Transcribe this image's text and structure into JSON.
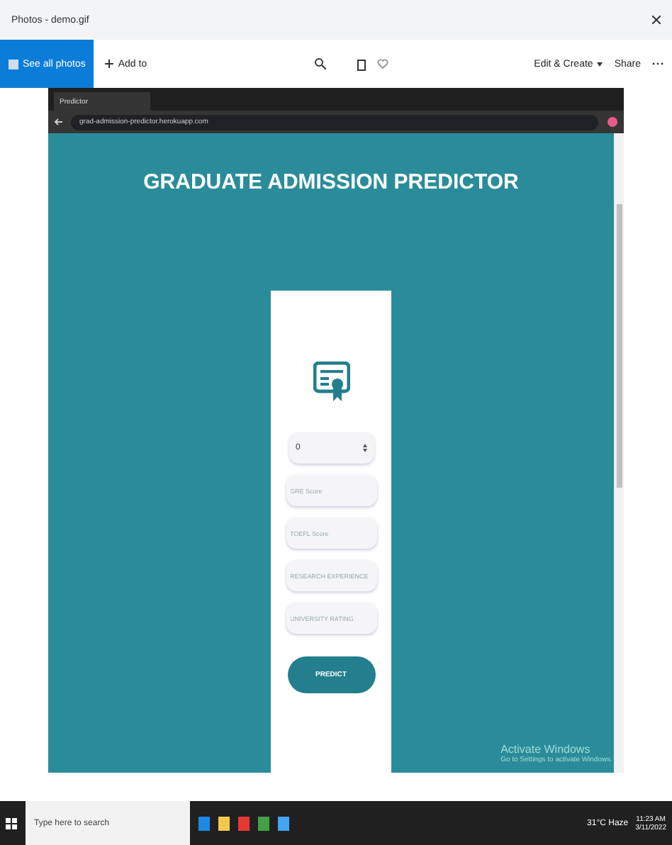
{
  "window": {
    "title": "Photos - demo.gif"
  },
  "toolbar": {
    "see_all": "See all photos",
    "add_to": "Add to",
    "edit_create": "Edit & Create",
    "share": "Share"
  },
  "browser": {
    "tab": "Predictor",
    "url": "grad-admission-predictor.herokuapp.com"
  },
  "page": {
    "heading": "GRADUATE ADMISSION PREDICTOR",
    "select_value": "0",
    "fields": [
      {
        "placeholder": "GRE Score"
      },
      {
        "placeholder": "TOEFL Score"
      },
      {
        "placeholder": "RESEARCH EXPERIENCE"
      },
      {
        "placeholder": "UNIVERSITY RATING"
      }
    ],
    "button": "PREDICT"
  },
  "watermark_notice": {
    "title": "Activate Windows",
    "subtitle": "Go to Settings to activate Windows."
  },
  "taskbar": {
    "search_placeholder": "Type here to search",
    "weather": "31°C Haze",
    "time": "11:23 AM",
    "date": "3/11/2022"
  }
}
